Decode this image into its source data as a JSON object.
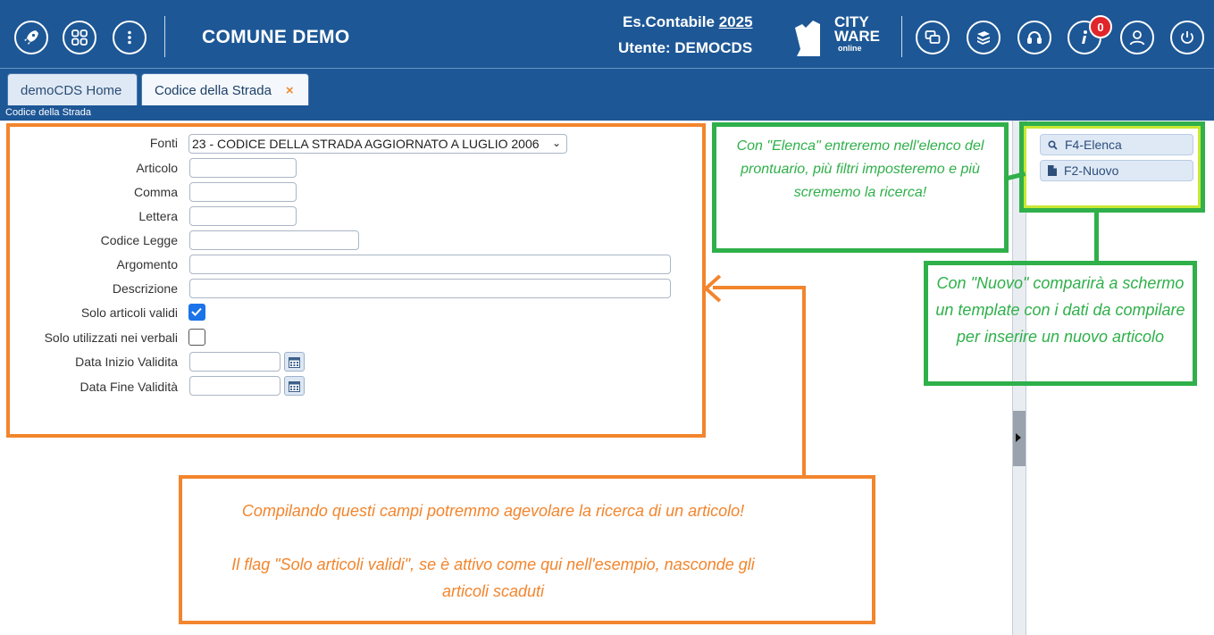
{
  "header": {
    "app_title": "COMUNE DEMO",
    "es_contabile_label": "Es.Contabile",
    "es_contabile_year": "2025",
    "user_line": "Utente: DEMOCDS",
    "logo_line1": "CITY",
    "logo_line2": "WARE",
    "logo_line3": "online",
    "notification_count": "0",
    "icons": [
      "rocket-icon",
      "apps-grid-icon",
      "more-vertical-icon",
      "windows-icon",
      "book-icon",
      "headset-icon",
      "info-icon",
      "user-icon",
      "power-icon"
    ]
  },
  "tabs": [
    {
      "label": "demoCDS Home"
    },
    {
      "label": "Codice della Strada",
      "close": "×"
    }
  ],
  "breadcrumb": "Codice della Strada",
  "form": {
    "fonti_label": "Fonti",
    "fonti_value": "23 - CODICE DELLA STRADA AGGIORNATO A LUGLIO 2006",
    "articolo_label": "Articolo",
    "comma_label": "Comma",
    "lettera_label": "Lettera",
    "codice_legge_label": "Codice Legge",
    "argomento_label": "Argomento",
    "descrizione_label": "Descrizione",
    "solo_validi_label": "Solo articoli validi",
    "solo_validi_checked": true,
    "solo_utilizzati_label": "Solo utilizzati nei verbali",
    "solo_utilizzati_checked": false,
    "data_inizio_label": "Data Inizio Validita",
    "data_fine_label": "Data Fine Validità"
  },
  "side_buttons": {
    "elenca": "F4-Elenca",
    "nuovo": "F2-Nuovo"
  },
  "annotations": {
    "elenca_note": "Con \"Elenca\" entreremo nell'elenco del prontuario, più filtri imposteremo e più scrememo la ricerca!",
    "nuovo_note": "Con \"Nuovo\" comparirà a schermo un template con i dati da compilare per inserire un nuovo articolo",
    "fields_note_1": "Compilando questi campi potremmo agevolare la ricerca di un articolo!",
    "fields_note_2": "Il flag \"Solo articoli validi\", se è attivo come qui nell'esempio, nasconde gli articoli scaduti"
  },
  "colors": {
    "header_blue": "#1d5796",
    "annotation_orange": "#f2852d",
    "annotation_green": "#2fb04a",
    "badge_red": "#e0262a"
  }
}
